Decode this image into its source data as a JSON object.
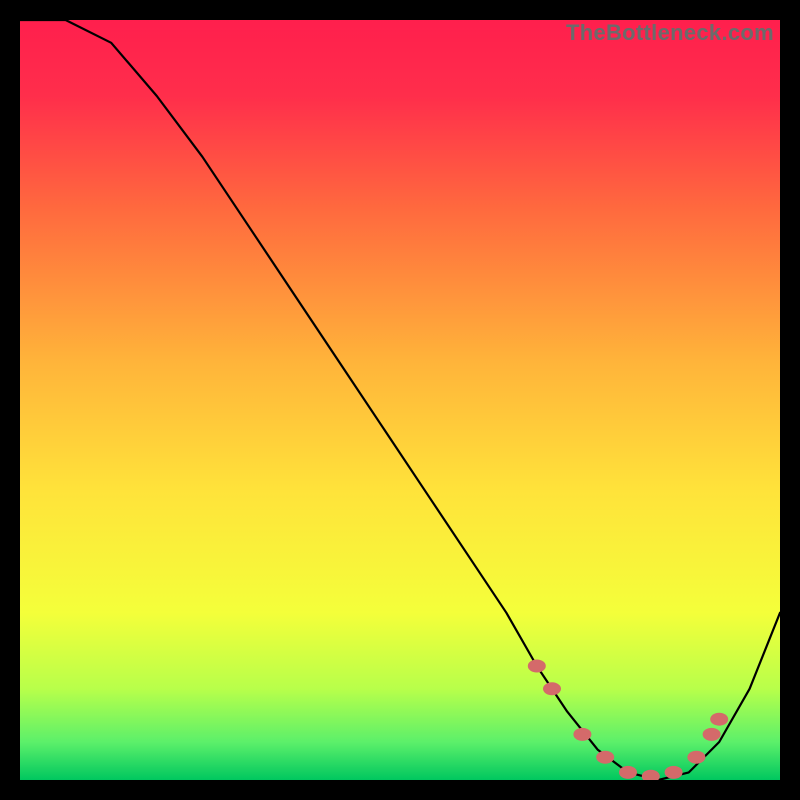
{
  "watermark": "TheBottleneck.com",
  "chart_data": {
    "type": "line",
    "title": "",
    "xlabel": "",
    "ylabel": "",
    "xlim": [
      0,
      100
    ],
    "ylim": [
      0,
      100
    ],
    "grid": false,
    "background_gradient": {
      "top": "#ff1f4d",
      "mid": "#ffd400",
      "bottom": "#00c75f"
    },
    "series": [
      {
        "name": "bottleneck-curve",
        "x": [
          0,
          6,
          12,
          18,
          24,
          30,
          36,
          42,
          48,
          54,
          60,
          64,
          68,
          72,
          76,
          80,
          84,
          88,
          92,
          96,
          100
        ],
        "y": [
          100,
          100,
          97,
          90,
          82,
          73,
          64,
          55,
          46,
          37,
          28,
          22,
          15,
          9,
          4,
          1,
          0,
          1,
          5,
          12,
          22
        ]
      }
    ],
    "markers": {
      "name": "highlight-points",
      "color": "#d46a6a",
      "points": [
        {
          "x": 68,
          "y": 15
        },
        {
          "x": 70,
          "y": 12
        },
        {
          "x": 74,
          "y": 6
        },
        {
          "x": 77,
          "y": 3
        },
        {
          "x": 80,
          "y": 1
        },
        {
          "x": 83,
          "y": 0.5
        },
        {
          "x": 86,
          "y": 1
        },
        {
          "x": 89,
          "y": 3
        },
        {
          "x": 91,
          "y": 6
        },
        {
          "x": 92,
          "y": 8
        }
      ]
    }
  }
}
